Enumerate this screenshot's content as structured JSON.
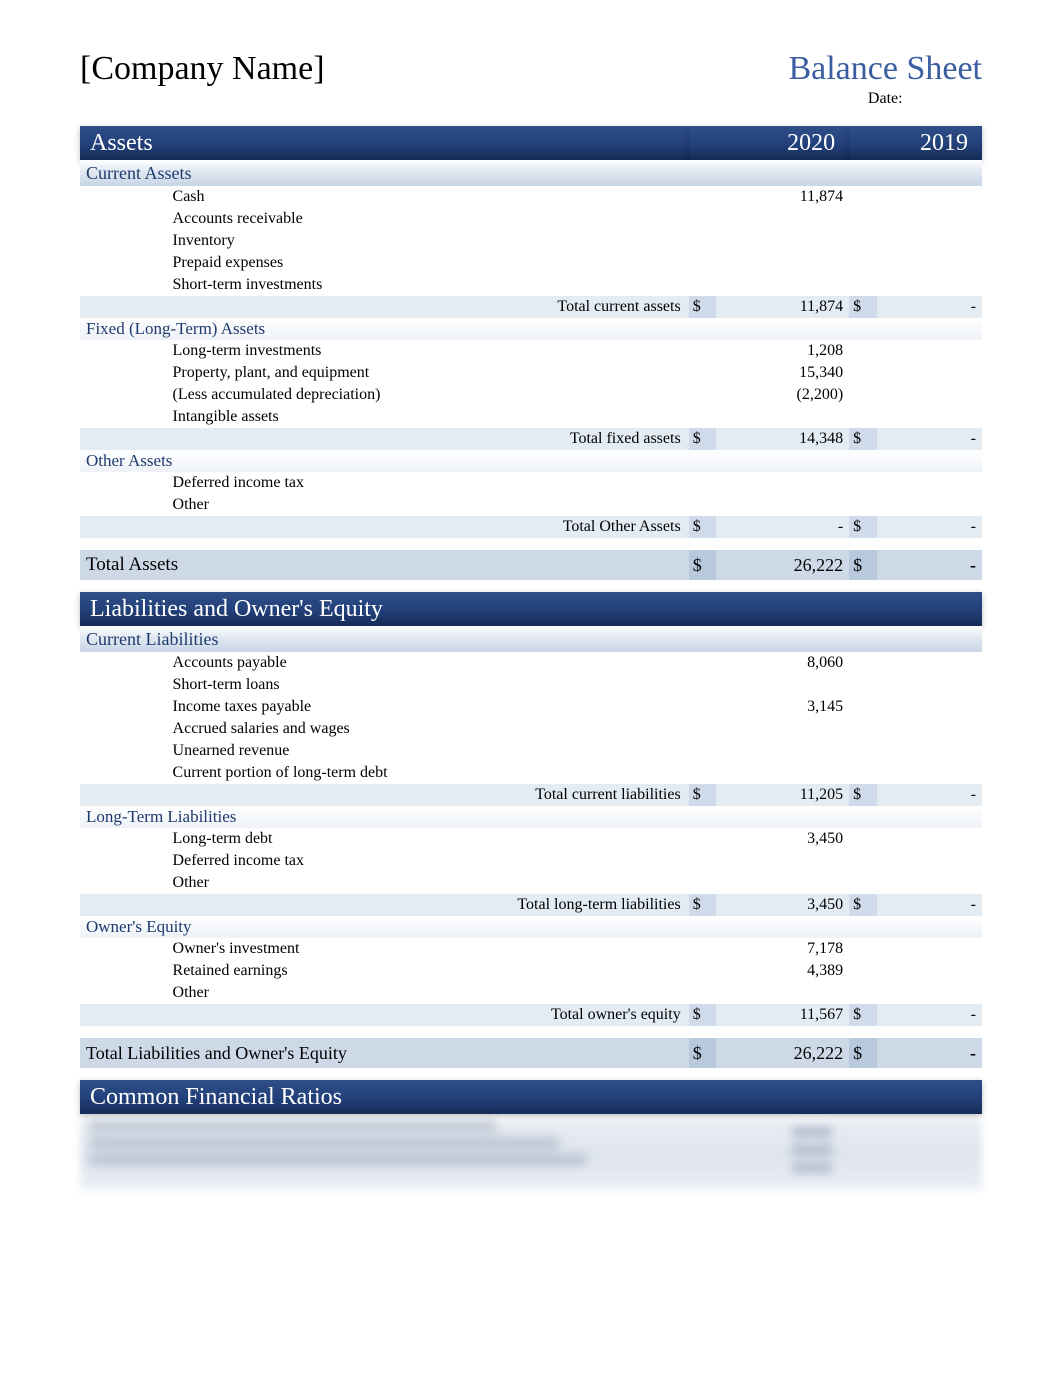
{
  "header": {
    "company": "[Company Name]",
    "title": "Balance Sheet",
    "date_label": "Date:"
  },
  "years": {
    "y1": "2020",
    "y2": "2019"
  },
  "sections": {
    "assets": {
      "title": "Assets",
      "current": {
        "title": "Current Assets",
        "items": [
          {
            "label": "Cash",
            "v1": "11,874",
            "v2": ""
          },
          {
            "label": "Accounts receivable",
            "v1": "",
            "v2": ""
          },
          {
            "label": "Inventory",
            "v1": "",
            "v2": ""
          },
          {
            "label": "Prepaid expenses",
            "v1": "",
            "v2": ""
          },
          {
            "label": "Short-term investments",
            "v1": "",
            "v2": ""
          }
        ],
        "total": {
          "label": "Total current assets",
          "d1": "$",
          "v1": "11,874",
          "d2": "$",
          "v2": "-"
        }
      },
      "fixed": {
        "title": "Fixed (Long-Term) Assets",
        "items": [
          {
            "label": "Long-term investments",
            "v1": "1,208",
            "v2": ""
          },
          {
            "label": "Property, plant, and equipment",
            "v1": "15,340",
            "v2": ""
          },
          {
            "label": "(Less accumulated depreciation)",
            "v1": "(2,200)",
            "v2": ""
          },
          {
            "label": "Intangible assets",
            "v1": "",
            "v2": ""
          }
        ],
        "total": {
          "label": "Total fixed assets",
          "d1": "$",
          "v1": "14,348",
          "d2": "$",
          "v2": "-"
        }
      },
      "other": {
        "title": "Other Assets",
        "items": [
          {
            "label": "Deferred income tax",
            "v1": "",
            "v2": ""
          },
          {
            "label": "Other",
            "v1": "",
            "v2": ""
          }
        ],
        "total": {
          "label": "Total Other Assets",
          "d1": "$",
          "v1": "-",
          "d2": "$",
          "v2": "-"
        }
      },
      "grand": {
        "label": "Total Assets",
        "d1": "$",
        "v1": "26,222",
        "d2": "$",
        "v2": "-"
      }
    },
    "liab": {
      "title": "Liabilities and Owner's Equity",
      "current": {
        "title": "Current Liabilities",
        "items": [
          {
            "label": "Accounts payable",
            "v1": "8,060",
            "v2": ""
          },
          {
            "label": "Short-term loans",
            "v1": "",
            "v2": ""
          },
          {
            "label": "Income taxes payable",
            "v1": "3,145",
            "v2": ""
          },
          {
            "label": "Accrued salaries and wages",
            "v1": "",
            "v2": ""
          },
          {
            "label": "Unearned revenue",
            "v1": "",
            "v2": ""
          },
          {
            "label": "Current portion of long-term debt",
            "v1": "",
            "v2": ""
          }
        ],
        "total": {
          "label": "Total current liabilities",
          "d1": "$",
          "v1": "11,205",
          "d2": "$",
          "v2": "-"
        }
      },
      "longterm": {
        "title": "Long-Term Liabilities",
        "items": [
          {
            "label": "Long-term debt",
            "v1": "3,450",
            "v2": ""
          },
          {
            "label": "Deferred income tax",
            "v1": "",
            "v2": ""
          },
          {
            "label": "Other",
            "v1": "",
            "v2": ""
          }
        ],
        "total": {
          "label": "Total long-term liabilities",
          "d1": "$",
          "v1": "3,450",
          "d2": "$",
          "v2": "-"
        }
      },
      "equity": {
        "title": "Owner's Equity",
        "items": [
          {
            "label": "Owner's investment",
            "v1": "7,178",
            "v2": ""
          },
          {
            "label": "Retained earnings",
            "v1": "4,389",
            "v2": ""
          },
          {
            "label": "Other",
            "v1": "",
            "v2": ""
          }
        ],
        "total": {
          "label": "Total owner's equity",
          "d1": "$",
          "v1": "11,567",
          "d2": "$",
          "v2": "-"
        }
      },
      "grand": {
        "label": "Total Liabilities and Owner's Equity",
        "d1": "$",
        "v1": "26,222",
        "d2": "$",
        "v2": "-"
      }
    },
    "ratios": {
      "title": "Common Financial Ratios"
    }
  }
}
